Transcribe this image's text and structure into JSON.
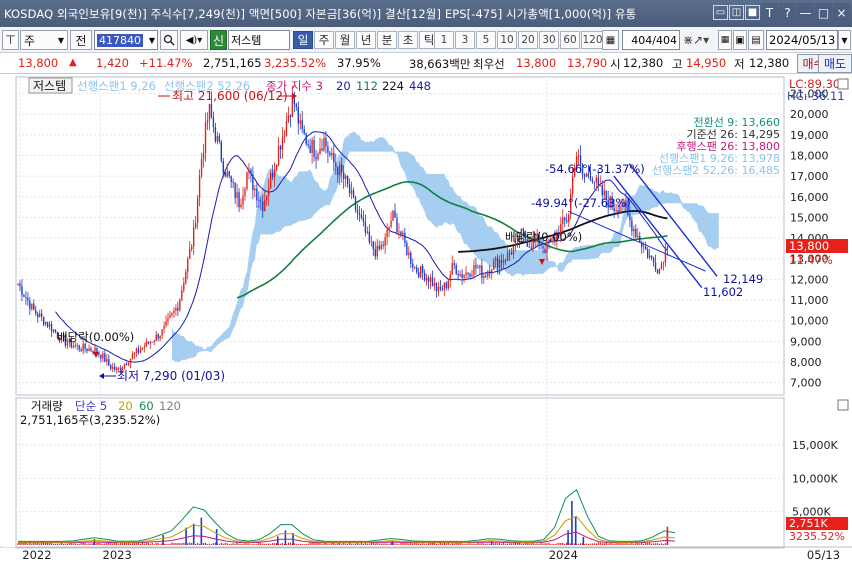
{
  "window": {
    "title": "KOSDAQ 외국인보유[9(천)] 주식수[7,249(천)] 액면[500] 자본금[36(억)] 결산[12월] EPS[-475] 시가총액[1,000(억)] 유통",
    "controls": [
      "▭",
      "◫",
      "■",
      "T",
      "?",
      "—",
      "□",
      "×"
    ]
  },
  "toolbar": {
    "mode_label": "주",
    "prev_label": "전",
    "stock_code": "417840",
    "credit_label": "신",
    "stock_name": "저스템",
    "periods": [
      "일",
      "주",
      "월",
      "년",
      "분",
      "초",
      "틱"
    ],
    "active_period": "일",
    "intervals": [
      "1",
      "3",
      "5",
      "10",
      "20",
      "30",
      "60",
      "120"
    ],
    "count_value": "404",
    "count_total": "/404",
    "date_value": "2024/05/13"
  },
  "quote": {
    "price": "13,800",
    "arrow": "▲",
    "change": "1,420",
    "change_pct": "+11.47%",
    "volume": "2,751,165",
    "volume_ratio": "3,235.52%",
    "turnover": "37.95%",
    "amount": "38,663백만",
    "priority_label": "최우선",
    "ask": "13,800",
    "bid": "13,790",
    "open_label": "시",
    "open": "12,380",
    "high_label": "고",
    "high": "14,950",
    "low_label": "저",
    "low": "12,380",
    "buy_label": "매수",
    "sell_label": "매도"
  },
  "chart_data": [
    {
      "type": "candlestick",
      "title": "저스템",
      "legend": [
        {
          "name": "선행스팬1 9,26",
          "color": "#8fc3ea"
        },
        {
          "name": "선행스팬2 52,26",
          "color": "#8fc3ea"
        },
        {
          "name": "종가 지수 3",
          "color": "#c01a7a"
        },
        {
          "name": "20",
          "color": "#1b1bb0"
        },
        {
          "name": "112",
          "color": "#11803a"
        },
        {
          "name": "224",
          "color": "#111111"
        },
        {
          "name": "448",
          "color": "#1b1bb0"
        }
      ],
      "indicator_readout": [
        {
          "text": "LC:89.30",
          "color": "#cc2020"
        },
        {
          "text": "HC:-36.11",
          "color": "#2a3fb0"
        },
        {
          "text": "전환선 9: 13,660",
          "color": "#149080"
        },
        {
          "text": "기준선 26: 14,295",
          "color": "#333333"
        },
        {
          "text": "후행스팬 26: 13,800",
          "color": "#c01a7a"
        },
        {
          "text": "선행스팬1 9,26: 13,978",
          "color": "#8fc3ea"
        },
        {
          "text": "선행스팬2 52,26: 16,485",
          "color": "#8fc3ea"
        }
      ],
      "annotations": [
        {
          "text": "최고 21,600 (06/12)",
          "color": "#cc1010"
        },
        {
          "text": "최저 7,290 (01/03)",
          "color": "#1010a0"
        },
        {
          "text": "배당락(0.00%)",
          "color": "#111111"
        },
        {
          "text": "배당락(0.00%)",
          "color": "#111111"
        },
        {
          "text": "-54.66°(-31.37%)",
          "color": "#1010a0"
        },
        {
          "text": "-49.94°(-27.63%)",
          "color": "#1010a0"
        },
        {
          "text": "12,149",
          "color": "#1010a0"
        },
        {
          "text": "11,602",
          "color": "#1010a0"
        }
      ],
      "y_ticks": [
        21000,
        20000,
        19000,
        18000,
        17000,
        16000,
        15000,
        14000,
        13000,
        12000,
        11000,
        10000,
        9000,
        8000,
        7000
      ],
      "ylim": [
        6500,
        21700
      ],
      "current_price_tag": {
        "price": "13,800",
        "pct": "11.47%"
      },
      "x_ticks": [
        "2022",
        "2023",
        "2024",
        "05/13"
      ],
      "close_series_approx": [
        [
          0.0,
          11800
        ],
        [
          0.02,
          10500
        ],
        [
          0.04,
          9800
        ],
        [
          0.06,
          9000
        ],
        [
          0.08,
          8700
        ],
        [
          0.1,
          8600
        ],
        [
          0.11,
          8300
        ],
        [
          0.12,
          7800
        ],
        [
          0.13,
          7600
        ],
        [
          0.15,
          8300
        ],
        [
          0.17,
          8900
        ],
        [
          0.19,
          9500
        ],
        [
          0.21,
          10800
        ],
        [
          0.22,
          12500
        ],
        [
          0.23,
          14200
        ],
        [
          0.24,
          17800
        ],
        [
          0.25,
          20200
        ],
        [
          0.26,
          18800
        ],
        [
          0.27,
          17400
        ],
        [
          0.28,
          16500
        ],
        [
          0.29,
          15700
        ],
        [
          0.3,
          17200
        ],
        [
          0.31,
          16400
        ],
        [
          0.32,
          15600
        ],
        [
          0.33,
          16800
        ],
        [
          0.34,
          18200
        ],
        [
          0.35,
          19500
        ],
        [
          0.36,
          20800
        ],
        [
          0.37,
          19200
        ],
        [
          0.38,
          18600
        ],
        [
          0.39,
          18200
        ],
        [
          0.4,
          18800
        ],
        [
          0.41,
          17800
        ],
        [
          0.42,
          17300
        ],
        [
          0.43,
          16600
        ],
        [
          0.44,
          15600
        ],
        [
          0.45,
          14700
        ],
        [
          0.46,
          13700
        ],
        [
          0.47,
          13300
        ],
        [
          0.48,
          13800
        ],
        [
          0.49,
          15100
        ],
        [
          0.5,
          14300
        ],
        [
          0.51,
          13300
        ],
        [
          0.52,
          12500
        ],
        [
          0.53,
          12300
        ],
        [
          0.54,
          12000
        ],
        [
          0.55,
          11400
        ],
        [
          0.56,
          11700
        ],
        [
          0.57,
          12700
        ],
        [
          0.58,
          12200
        ],
        [
          0.59,
          12400
        ],
        [
          0.6,
          12600
        ],
        [
          0.61,
          12200
        ],
        [
          0.62,
          12700
        ],
        [
          0.63,
          12900
        ],
        [
          0.64,
          13100
        ],
        [
          0.65,
          13600
        ],
        [
          0.66,
          14200
        ],
        [
          0.67,
          13700
        ],
        [
          0.68,
          13900
        ],
        [
          0.69,
          13500
        ],
        [
          0.7,
          13900
        ],
        [
          0.71,
          14500
        ],
        [
          0.72,
          15000
        ],
        [
          0.73,
          18200
        ],
        [
          0.74,
          16900
        ],
        [
          0.75,
          17200
        ],
        [
          0.76,
          16300
        ],
        [
          0.77,
          15900
        ],
        [
          0.78,
          15500
        ],
        [
          0.79,
          15700
        ],
        [
          0.8,
          14900
        ],
        [
          0.81,
          14200
        ],
        [
          0.82,
          13500
        ],
        [
          0.83,
          12900
        ],
        [
          0.84,
          12500
        ],
        [
          0.85,
          13800
        ]
      ]
    },
    {
      "type": "bar",
      "title": "거래량",
      "legend": [
        {
          "name": "단순 5",
          "color": "#3a3ab0"
        },
        {
          "name": "20",
          "color": "#c0a000"
        },
        {
          "name": "60",
          "color": "#119050"
        },
        {
          "name": "120",
          "color": "#808080"
        }
      ],
      "readout": "2,751,165주(3,235.52%)",
      "y_ticks": [
        "15,000K",
        "10,000K",
        "5,000K"
      ],
      "ylim": [
        0,
        18000
      ],
      "current_tag": {
        "value": "2,751K",
        "pct": "3235.52%"
      },
      "values_approx_k": [
        [
          0.1,
          900
        ],
        [
          0.19,
          1500
        ],
        [
          0.22,
          2600
        ],
        [
          0.23,
          3200
        ],
        [
          0.24,
          4100
        ],
        [
          0.26,
          2400
        ],
        [
          0.34,
          1300
        ],
        [
          0.35,
          2200
        ],
        [
          0.36,
          1800
        ],
        [
          0.49,
          700
        ],
        [
          0.62,
          700
        ],
        [
          0.72,
          2200
        ],
        [
          0.725,
          6600
        ],
        [
          0.73,
          4300
        ],
        [
          0.74,
          1200
        ],
        [
          0.85,
          2751
        ]
      ]
    }
  ]
}
